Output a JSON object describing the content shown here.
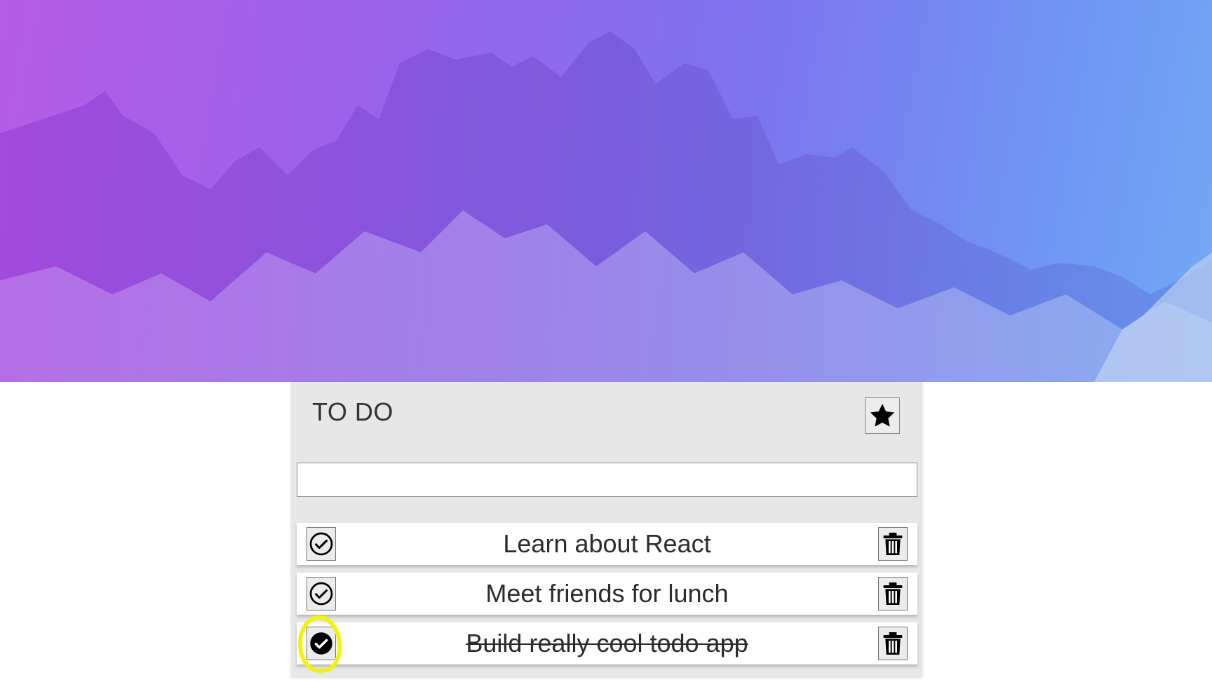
{
  "app": {
    "title": "TO DO"
  },
  "header": {
    "star_icon": "star-icon",
    "star_tooltip": ""
  },
  "new_todo": {
    "value": "",
    "placeholder": ""
  },
  "todos": [
    {
      "text": "Learn about React",
      "completed": false,
      "check_icon": "check-circle-outline-icon",
      "delete_icon": "trash-icon"
    },
    {
      "text": "Meet friends for lunch",
      "completed": false,
      "check_icon": "check-circle-outline-icon",
      "delete_icon": "trash-icon"
    },
    {
      "text": "Build really cool todo app",
      "completed": true,
      "check_icon": "check-circle-filled-icon",
      "delete_icon": "trash-icon"
    }
  ],
  "colors": {
    "gradient_start": "#b65ce6",
    "gradient_end": "#72a9f3",
    "card_bg": "#e7e7e7",
    "highlight": "#f2f20e"
  }
}
